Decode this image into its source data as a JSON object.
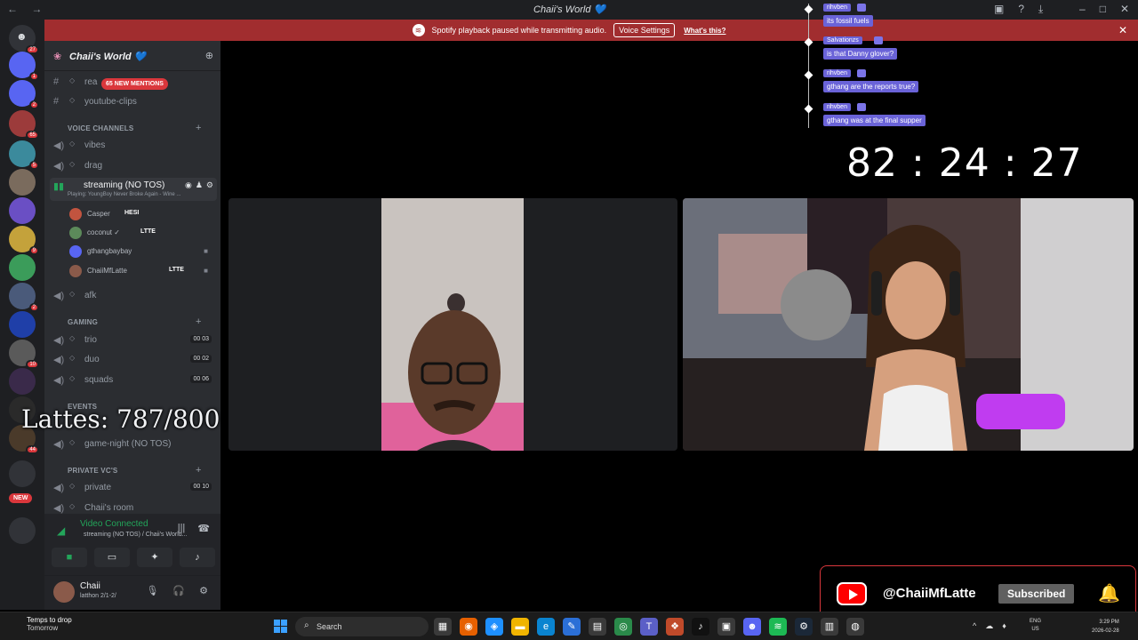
{
  "window": {
    "title": "Chaii's World 💙"
  },
  "banner": {
    "message": "Spotify playback paused while transmitting audio.",
    "voice_settings": "Voice Settings",
    "whats_this": "What's this?"
  },
  "rail": {
    "badges": [
      "27",
      "1",
      "2",
      "65",
      "5",
      "9",
      "2",
      "10",
      "44"
    ],
    "new_label": "NEW"
  },
  "server": {
    "name": "Chaii's World 💙"
  },
  "channels": {
    "top": [
      {
        "label": "rea"
      },
      {
        "label": "youtube-clips"
      }
    ],
    "mentions": "65 NEW MENTIONS",
    "voice_category": "VOICE CHANNELS",
    "voice": [
      {
        "label": "vibes"
      },
      {
        "label": "drag"
      }
    ],
    "active": {
      "label": "streaming (NO TOS)",
      "activity": "Playing: YoungBoy Never Broke Again - Wine ..."
    },
    "members": [
      {
        "name": "Casper",
        "tag": "HESI",
        "color": "#c2543f"
      },
      {
        "name": "coconut ✓",
        "tag": "LTTE",
        "color": "#5c8a5a"
      },
      {
        "name": "gthangbaybay",
        "tag": "",
        "color": "#5865f2"
      },
      {
        "name": "ChaiiMfLatte",
        "tag": "LTTE",
        "color": "#8a5a4a"
      }
    ],
    "afk": "afk",
    "gaming_category": "GAMING",
    "gaming": [
      {
        "label": "trio",
        "a": "00",
        "b": "03"
      },
      {
        "label": "duo",
        "a": "00",
        "b": "02"
      },
      {
        "label": "squads",
        "a": "00",
        "b": "06"
      }
    ],
    "events_category": "EVENTS",
    "events": [
      {
        "label": "game-night (NO TOS)"
      }
    ],
    "private_category": "PRIVATE VC'S",
    "private": [
      {
        "label": "private",
        "a": "00",
        "b": "10"
      },
      {
        "label": "Chaii's room"
      }
    ]
  },
  "lattes_overlay": "Lattes: 787/800",
  "voice_panel": {
    "status": "Video Connected",
    "location": "streaming (NO TOS) / Chaii's World..."
  },
  "user_panel": {
    "name": "Chaii",
    "status": "latthon 2/1-2/"
  },
  "chat": [
    {
      "user": "rihvben",
      "text": "its fossil fuels"
    },
    {
      "user": "Salvationzs",
      "text": "is that Danny glover?"
    },
    {
      "user": "rihvben",
      "text": "gthang are the reports true?"
    },
    {
      "user": "rihvben",
      "text": "gthang was at the final supper"
    }
  ],
  "timer": "82 : 24 : 27",
  "youtube": {
    "handle": "@ChaiiMfLatte",
    "button": "Subscribed"
  },
  "taskbar": {
    "weather_title": "Temps to drop",
    "weather_sub": "Tomorrow",
    "search": "Search",
    "lang1": "ENG",
    "lang2": "US",
    "time": "3:29 PM",
    "date": "2026-02-28"
  },
  "colors": {
    "accent_green": "#23a55a",
    "banner_red": "#a12d2f",
    "chat_purple": "#6a63d8",
    "youtube_red": "#ff0000"
  }
}
